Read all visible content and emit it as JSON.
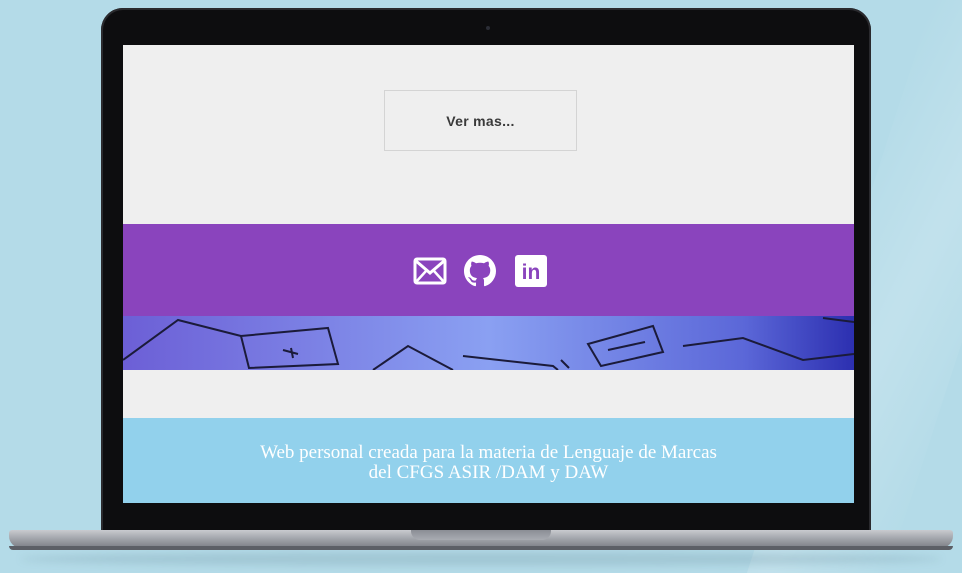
{
  "main": {
    "more_button_label": "Ver mas..."
  },
  "social": {
    "items": [
      {
        "name": "email",
        "icon": "envelope-icon"
      },
      {
        "name": "github",
        "icon": "github-icon"
      },
      {
        "name": "linkedin",
        "icon": "linkedin-icon",
        "text": "in"
      }
    ]
  },
  "footer": {
    "line1": "Web personal creada para la materia de Lenguaje de Marcas",
    "line2": "del CFGS ASIR /DAM y DAW"
  },
  "colors": {
    "background": "#b4dbe8",
    "social_bar": "#8a44bd",
    "footer": "#92d1ec",
    "page": "#efefef"
  }
}
